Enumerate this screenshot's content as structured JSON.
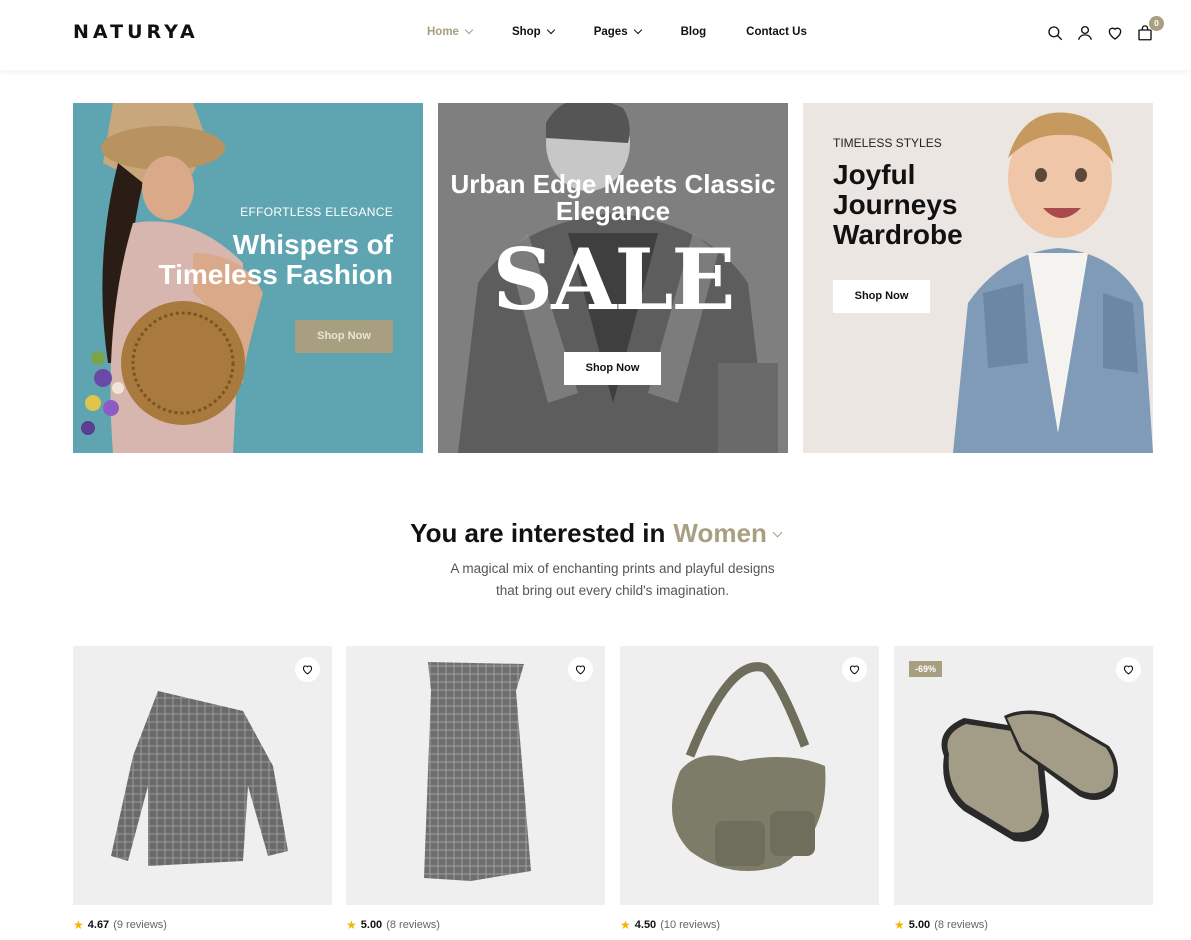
{
  "brand": {
    "logo": "NATURYA",
    "accent": "#a89e80"
  },
  "nav": [
    {
      "label": "Home",
      "active": true,
      "dropdown": true
    },
    {
      "label": "Shop",
      "dropdown": true
    },
    {
      "label": "Pages",
      "dropdown": true
    },
    {
      "label": "Blog",
      "dropdown": false
    },
    {
      "label": "Contact Us",
      "dropdown": false
    }
  ],
  "header_icons": [
    "search-icon",
    "user-icon",
    "heart-icon",
    "bag-icon"
  ],
  "cart": {
    "count": "0"
  },
  "banners": [
    {
      "eyebrow": "EFFORTLESS ELEGANCE",
      "title": "Whispers of Timeless Fashion",
      "button": "Shop Now",
      "bg": "#5fa4b1"
    },
    {
      "title": "Urban Edge Meets Classic Elegance",
      "sale": "SALE",
      "button": "Shop Now",
      "bg": "#7e7e7e"
    },
    {
      "eyebrow": "TIMELESS STYLES",
      "title": "Joyful Journeys Wardrobe",
      "button": "Shop Now",
      "bg": "#ece6e3"
    }
  ],
  "section": {
    "title_prefix": "You are interested in",
    "category": "Women",
    "subtitle_line1": "A magical mix of enchanting prints and playful designs",
    "subtitle_line2": "that bring out every child's imagination."
  },
  "products": [
    {
      "rating": "4.67",
      "reviews": "(9 reviews)",
      "discount": ""
    },
    {
      "rating": "5.00",
      "reviews": "(8 reviews)",
      "discount": ""
    },
    {
      "rating": "4.50",
      "reviews": "(10 reviews)",
      "discount": ""
    },
    {
      "rating": "5.00",
      "reviews": "(8 reviews)",
      "discount": "-69%"
    }
  ]
}
